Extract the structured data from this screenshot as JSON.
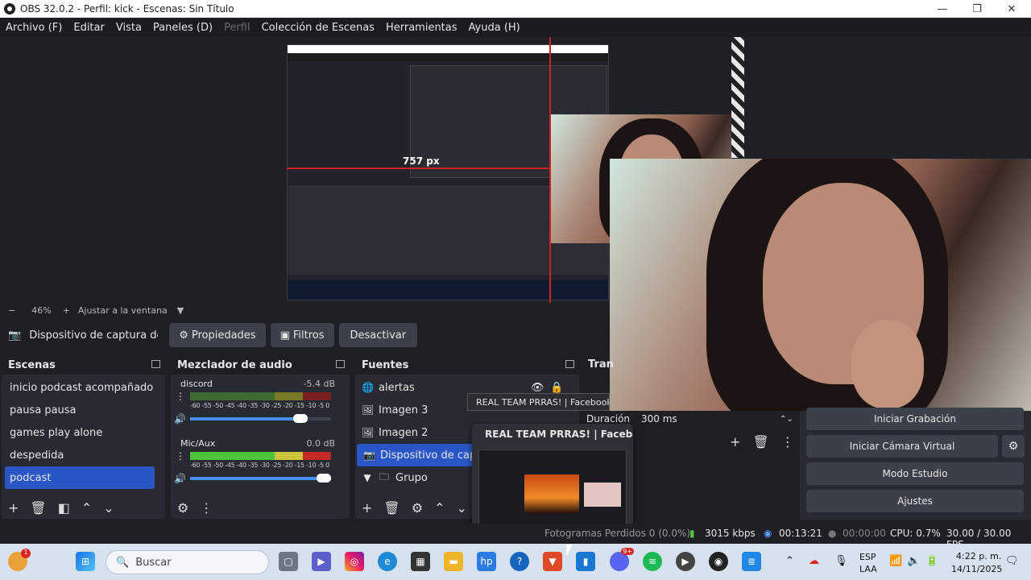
{
  "window": {
    "title": "OBS 32.0.2 - Perfil: kick - Escenas: Sin Título"
  },
  "menu": [
    "Archivo (F)",
    "Editar",
    "Vista",
    "Paneles (D)",
    "Perfil",
    "Colección de Escenas",
    "Herramientas",
    "Ayuda (H)"
  ],
  "preview": {
    "px_label": "757 px"
  },
  "zoom": {
    "minus": "−",
    "value": "46%",
    "plus": "+",
    "fit": "Ajustar a la ventana"
  },
  "source_toolbar": {
    "name": "Dispositivo de captura de v",
    "properties": "Propiedades",
    "filters": "Filtros",
    "deactivate": "Desactivar"
  },
  "scenes": {
    "title": "Escenas",
    "items": [
      "inicio podcast acompañado",
      "pausa pausa",
      "games play alone",
      "despedida",
      "podcast"
    ],
    "selected": "podcast"
  },
  "mixer": {
    "title": "Mezclador de audio",
    "scale": "-60 -55 -50 -45 -40 -35 -30 -25 -20 -15 -10 -5 0",
    "channels": [
      {
        "name": "discord",
        "db": "-5.4 dB",
        "level": 0.78
      },
      {
        "name": "Mic/Aux",
        "db": "0.0 dB",
        "level": 1.0
      }
    ]
  },
  "sources": {
    "title": "Fuentes",
    "items": [
      {
        "name": "alertas",
        "icon": "globe-icon"
      },
      {
        "name": "Imagen 3",
        "icon": "image-icon"
      },
      {
        "name": "Imagen 2",
        "icon": "image-icon"
      },
      {
        "name": "Dispositivo de captura",
        "icon": "camera-icon"
      },
      {
        "name": "Grupo",
        "icon": "folder-icon"
      }
    ]
  },
  "transitions": {
    "title": "Tran",
    "duration_label": "Duración",
    "duration_value": "300 ms"
  },
  "controls": {
    "record": "Iniciar Grabación",
    "virtual_cam": "Iniciar Cámara Virtual",
    "studio": "Modo Estudio",
    "settings": "Ajustes"
  },
  "tooltip": "REAL TEAM PRRAS! | Facebook - B",
  "thumbnail": {
    "title": "REAL TEAM PRRAS! | Facebook ..."
  },
  "status": {
    "frames": "Fotogramas Perdidos 0 (0.0%)",
    "kbps": "3015 kbps",
    "live_time": "00:13:21",
    "rec_time": "00:00:00",
    "cpu": "CPU: 0.7%",
    "fps": "30.00 / 30.00 FPS"
  },
  "taskbar": {
    "search_placeholder": "Buscar",
    "lang1": "ESP",
    "lang2": "LAA",
    "time": "4:22 p. m.",
    "date": "14/11/2025",
    "weather_badge": "1",
    "discord_badge": "9+"
  }
}
